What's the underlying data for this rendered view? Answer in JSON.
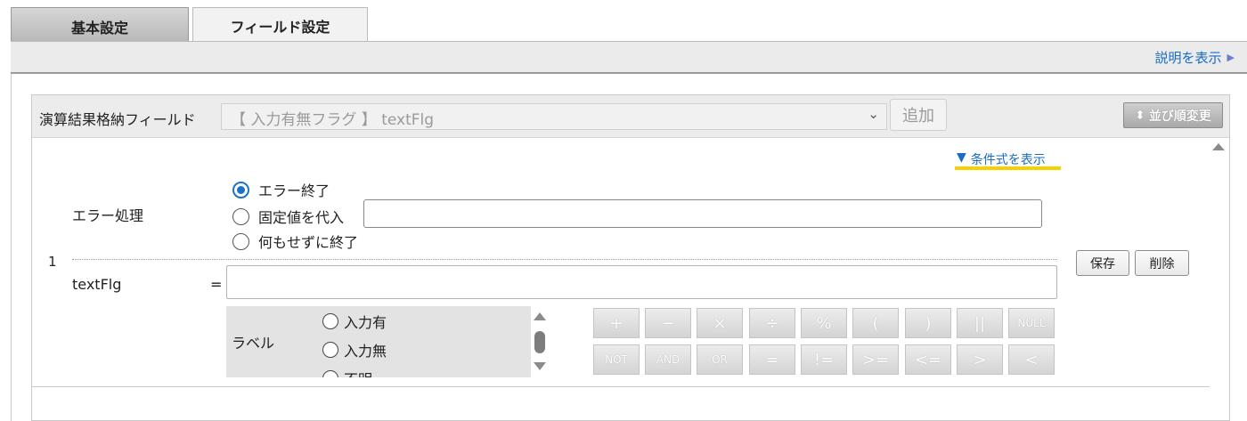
{
  "tabs": [
    {
      "label": "基本設定",
      "active": false
    },
    {
      "label": "フィールド設定",
      "active": true
    }
  ],
  "header": {
    "help_link": "説明を表示",
    "help_icon": "triangle-right-icon"
  },
  "panel": {
    "result_field_label": "演算結果格納フィールド",
    "result_field_value": "【 入力有無フラグ 】 textFlg",
    "select_icon": "chevron-down-icon",
    "add_button": "追加",
    "sort_button": "並び順変更",
    "sort_icon": "sort-updown-icon"
  },
  "row": {
    "number": "1",
    "condition_link": "条件式を表示",
    "condition_icon": "triangle-down-icon",
    "error_label": "エラー処理",
    "error_options": [
      {
        "label": "エラー終了",
        "checked": true
      },
      {
        "label": "固定値を代入",
        "checked": false
      },
      {
        "label": "何もせずに終了",
        "checked": false
      }
    ],
    "fixed_value": "",
    "save_button": "保存",
    "delete_button": "削除",
    "variable_name": "textFlg",
    "equals": "=",
    "expression": "",
    "label_title": "ラベル",
    "label_options": [
      "入力有",
      "入力無",
      "不明"
    ]
  },
  "operators": {
    "row1": [
      "+",
      "−",
      "×",
      "÷",
      "%",
      "(",
      ")",
      "||",
      "NULL"
    ],
    "row2": [
      "NOT",
      "AND",
      "OR",
      "=",
      "!=",
      ">=",
      "<=",
      ">",
      "<"
    ]
  },
  "colors": {
    "accent": "#1a6bc2",
    "highlight": "#f7d000",
    "radio_checked": "#1a73c8"
  }
}
